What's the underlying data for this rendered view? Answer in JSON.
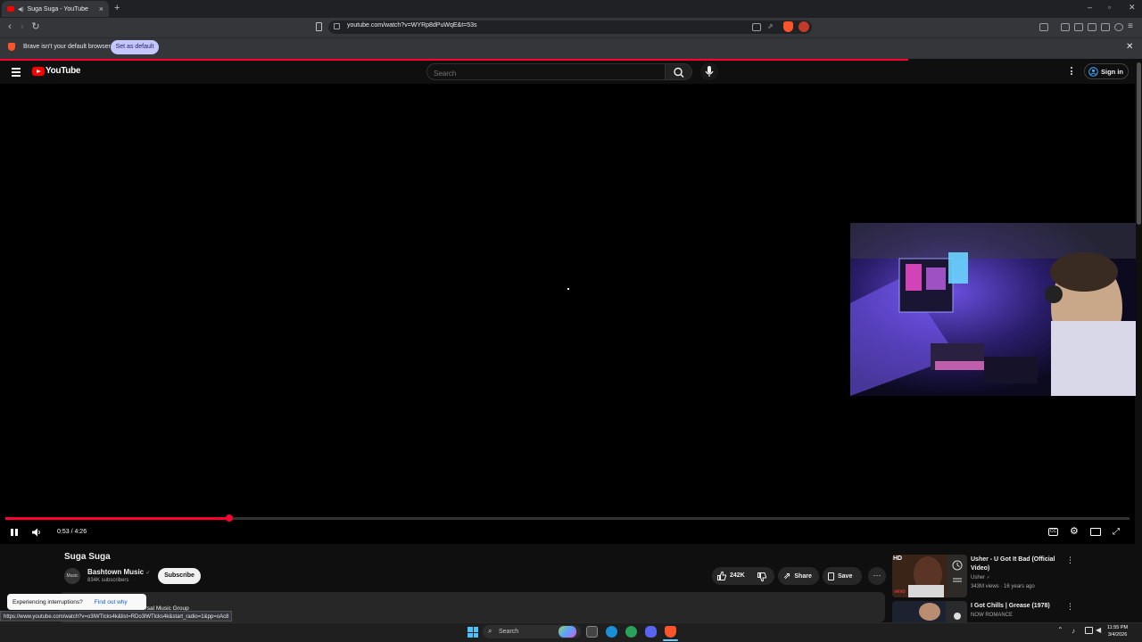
{
  "browser": {
    "tab_title": "Suga Suga - YouTube",
    "new_tab_symbol": "+",
    "url": "youtube.com/watch?v=WYRp8dPuWqE&t=53s",
    "notice_text": "Brave isn't your default browser",
    "set_default_label": "Set as default",
    "status_url": "https://www.youtube.com/watch?v=o3lWTlcks4k&list=RDo3lWTlcks4k&start_radio=1&pp=oAc8"
  },
  "youtube": {
    "logo_text": "YouTube",
    "search_placeholder": "Search",
    "signin_label": "Sign in"
  },
  "player": {
    "time_display": "0:53 / 4:26",
    "progress_fraction": 0.199
  },
  "video": {
    "title": "Suga Suga",
    "channel_name": "Bashtown Music",
    "channel_avatar_text": "Music",
    "subscribers": "834K subscribers",
    "subscribe_label": "Subscribe",
    "likes": "242K",
    "share_label": "Share",
    "save_label": "Save",
    "more_label": "···",
    "description_fragment": "ersal Music Group"
  },
  "toast": {
    "text": "Experiencing interruptions?",
    "link": "Find out why"
  },
  "recommendations": [
    {
      "title": "Usher - U Got It Bad (Official Video)",
      "channel": "Usher",
      "meta": "343M views · 16 years ago",
      "badge": "HD",
      "brand": "vevo"
    },
    {
      "title": "I Got Chills | Grease (1978)",
      "channel": "NOW ROMANCE",
      "meta": ""
    }
  ],
  "taskbar": {
    "search_label": "Search",
    "time": "11:55 PM",
    "date": "3/4/2026"
  },
  "colors": {
    "accent": "#ff0033",
    "youtube_red": "#ff0000",
    "link_blue": "#3ea6ff",
    "background": "#0f0f0f"
  }
}
